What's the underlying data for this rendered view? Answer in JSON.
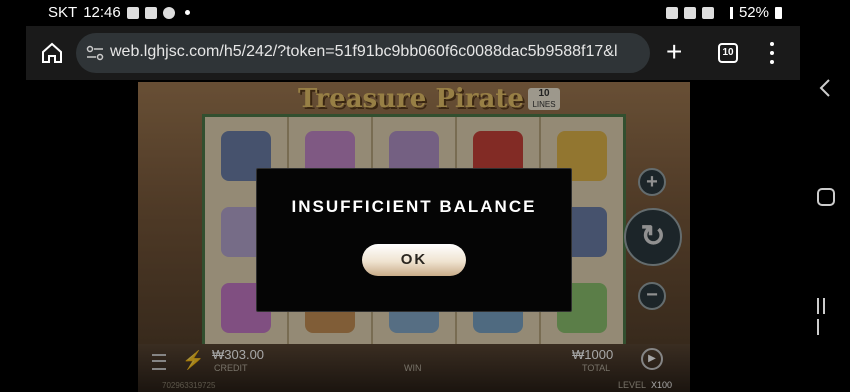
{
  "statusbar": {
    "carrier": "SKT",
    "time": "12:46",
    "battery": "52%"
  },
  "browser": {
    "url": "web.lghjsc.com/h5/242/?token=51f91bc9bb060f6c0088dac5b9588f17&l",
    "tab_count": "10"
  },
  "game": {
    "title": "Treasure Pirate",
    "lines_value": "10",
    "lines_label": "LINES",
    "credit_value": "₩303.00",
    "credit_label": "CREDIT",
    "win_label": "WIN",
    "total_value": "₩1000",
    "total_label": "TOTAL",
    "level_label": "LEVEL",
    "level_value": "X100",
    "session_id": "702963319725"
  },
  "dialog": {
    "message": "INSUFFICIENT BALANCE",
    "ok_label": "OK"
  },
  "colors": {
    "accent_gold": "#e9c46a",
    "dialog_bg": "#050505",
    "ok_button": "#efe3d0"
  }
}
